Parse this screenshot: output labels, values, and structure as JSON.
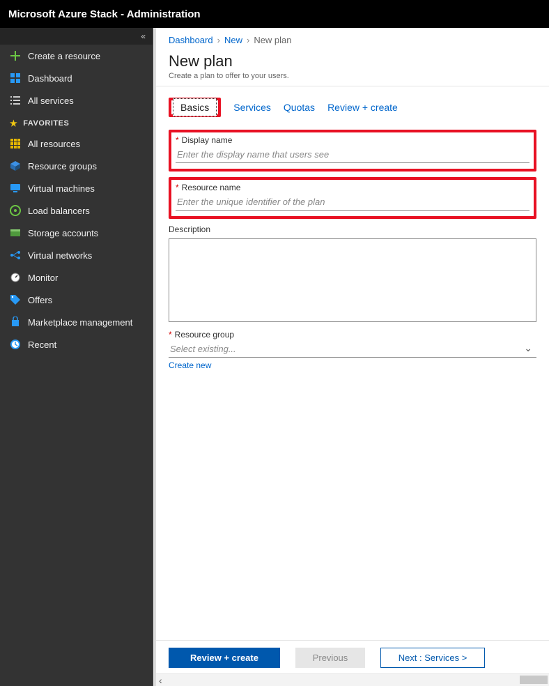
{
  "header": {
    "title": "Microsoft Azure Stack - Administration"
  },
  "sidebar": {
    "create_label": "Create a resource",
    "dashboard_label": "Dashboard",
    "all_services_label": "All services",
    "favorites_header": "FAVORITES",
    "items": [
      {
        "label": "All resources"
      },
      {
        "label": "Resource groups"
      },
      {
        "label": "Virtual machines"
      },
      {
        "label": "Load balancers"
      },
      {
        "label": "Storage accounts"
      },
      {
        "label": "Virtual networks"
      },
      {
        "label": "Monitor"
      },
      {
        "label": "Offers"
      },
      {
        "label": "Marketplace management"
      },
      {
        "label": "Recent"
      }
    ]
  },
  "breadcrumb": {
    "dashboard": "Dashboard",
    "new": "New",
    "current": "New plan"
  },
  "page": {
    "title": "New plan",
    "subtitle": "Create a plan to offer to your users."
  },
  "tabs": {
    "basics": "Basics",
    "services": "Services",
    "quotas": "Quotas",
    "review": "Review + create"
  },
  "form": {
    "display_name_label": "Display name",
    "display_name_placeholder": "Enter the display name that users see",
    "resource_name_label": "Resource name",
    "resource_name_placeholder": "Enter the unique identifier of the plan",
    "description_label": "Description",
    "resource_group_label": "Resource group",
    "resource_group_placeholder": "Select existing...",
    "create_new_link": "Create new"
  },
  "footer": {
    "review": "Review + create",
    "previous": "Previous",
    "next": "Next : Services >"
  }
}
